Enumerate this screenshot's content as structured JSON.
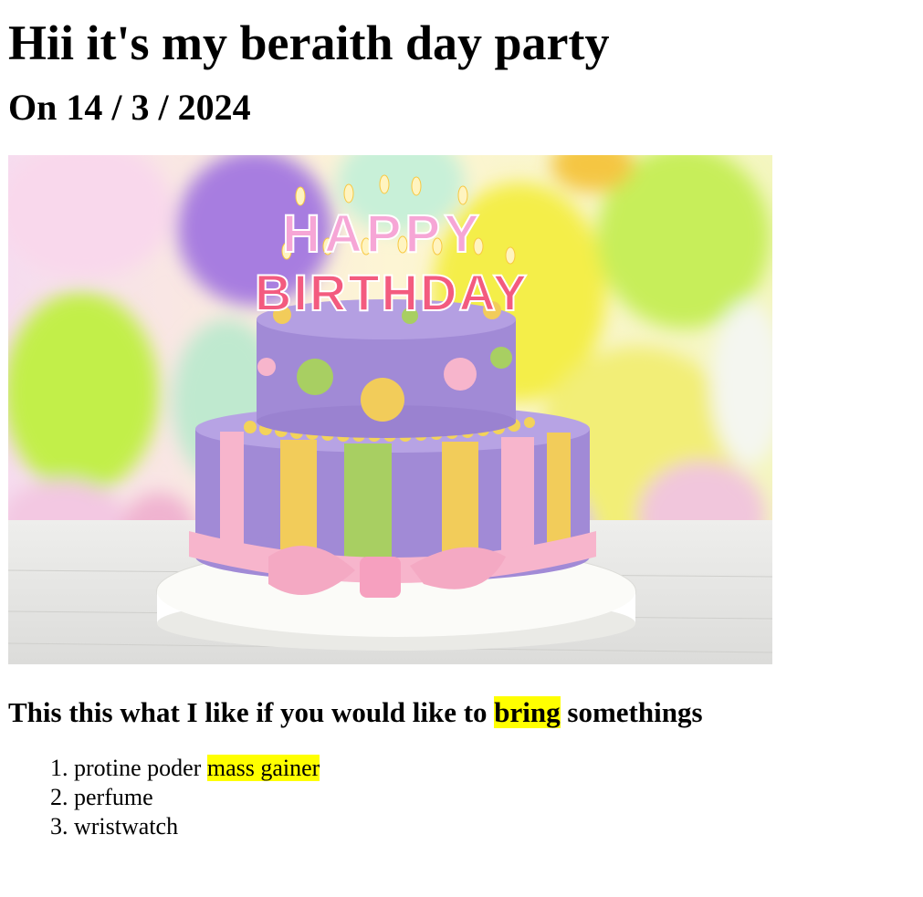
{
  "heading": "Hii it's my beraith day party",
  "date_line": "On 14 / 3 / 2024",
  "cake_image": {
    "candle_letters_top": "HAPPY",
    "candle_letters_bottom": "BIRTHDAY",
    "colors": {
      "balloon_purple": "#a77de0",
      "balloon_yellow": "#f4ee4a",
      "balloon_green": "#c7ee5a",
      "cake_purple": "#a18ad6",
      "ribbon_pink": "#f7b5cc",
      "stripe_yellow": "#f2cc5a",
      "stripe_green": "#a8cf62"
    }
  },
  "wish_heading": {
    "before": "This this what I like if you would like to ",
    "highlight": "bring",
    "after": " somethings"
  },
  "wish_list": [
    {
      "text": "protine poder ",
      "highlight": "mass gainer"
    },
    {
      "text": "perfume",
      "highlight": ""
    },
    {
      "text": "wristwatch",
      "highlight": ""
    }
  ],
  "highlight_color": "#ffff00"
}
